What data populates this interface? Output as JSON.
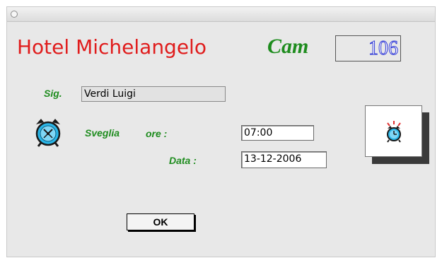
{
  "header": {
    "hotel_name": "Hotel Michelangelo",
    "cam_label": "Cam",
    "room_number": "106"
  },
  "guest": {
    "label": "Sig.",
    "name": "Verdi  Luigi"
  },
  "wakeup": {
    "label": "Sveglia",
    "time_label": "ore  :",
    "time_value": "07:00",
    "date_label": "Data  :",
    "date_value": "13-12-2006"
  },
  "actions": {
    "ok_label": "OK"
  },
  "icons": {
    "window": "close-circle-icon",
    "clock": "alarm-clock-icon",
    "alarm_button": "ringing-alarm-icon"
  },
  "colors": {
    "title": "#e01c1c",
    "labels": "#1e8c1e",
    "room_number": "#2d36d6",
    "clock": "#29b6e8"
  }
}
